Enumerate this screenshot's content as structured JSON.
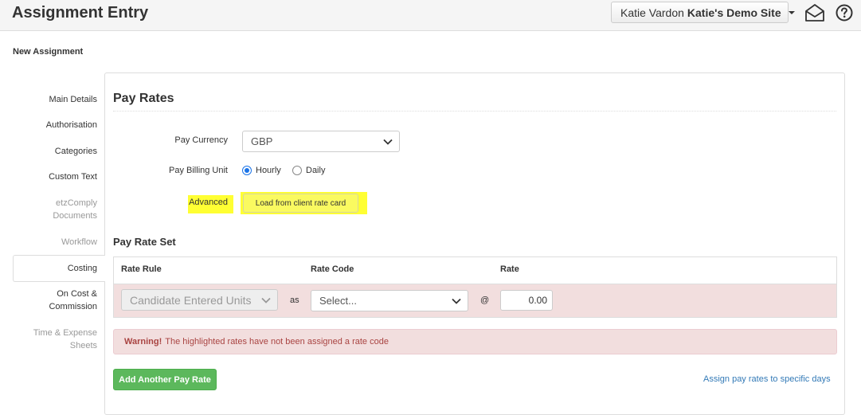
{
  "header": {
    "title": "Assignment Entry",
    "user_name": "Katie Vardon",
    "site_name": "Katie's Demo Site"
  },
  "page": {
    "subtitle": "New Assignment"
  },
  "sidebar": {
    "items": [
      {
        "label": "Main Details"
      },
      {
        "label": "Authorisation"
      },
      {
        "label": "Categories"
      },
      {
        "label": "Custom Text"
      },
      {
        "label_line1": "etzComply",
        "label_line2": "Documents"
      },
      {
        "label": "Workflow"
      },
      {
        "label": "Costing"
      },
      {
        "label_line1": "On Cost &",
        "label_line2": "Commission"
      },
      {
        "label_line1": "Time & Expense",
        "label_line2": "Sheets"
      }
    ]
  },
  "pay_rates": {
    "title": "Pay Rates",
    "currency_label": "Pay Currency",
    "currency_value": "GBP",
    "billing_unit_label": "Pay Billing Unit",
    "billing_options": [
      "Hourly",
      "Daily"
    ],
    "billing_selected": "Hourly",
    "advanced_label": "Advanced",
    "load_rate_card_button": "Load from client rate card"
  },
  "pay_rate_set": {
    "title": "Pay Rate Set",
    "columns": [
      "Rate Rule",
      "Rate Code",
      "Rate"
    ],
    "row": {
      "rate_rule": "Candidate Entered Units",
      "as_text": "as",
      "rate_code": "Select...",
      "at_text": "@",
      "rate": "0.00"
    }
  },
  "warning": {
    "strong": "Warning!",
    "text": "The highlighted rates have not been assigned a rate code"
  },
  "actions": {
    "add_pay_rate": "Add Another Pay Rate",
    "assign_link": "Assign pay rates to specific days"
  },
  "colors": {
    "highlight": "#ffff33",
    "success": "#5cb85c",
    "danger_bg": "#f2dede",
    "danger_text": "#a94442",
    "link": "#337ab7"
  },
  "icons": {
    "message": "envelope-open-icon",
    "help": "question-circle-icon",
    "select_chevron": "chevron-down-icon"
  }
}
